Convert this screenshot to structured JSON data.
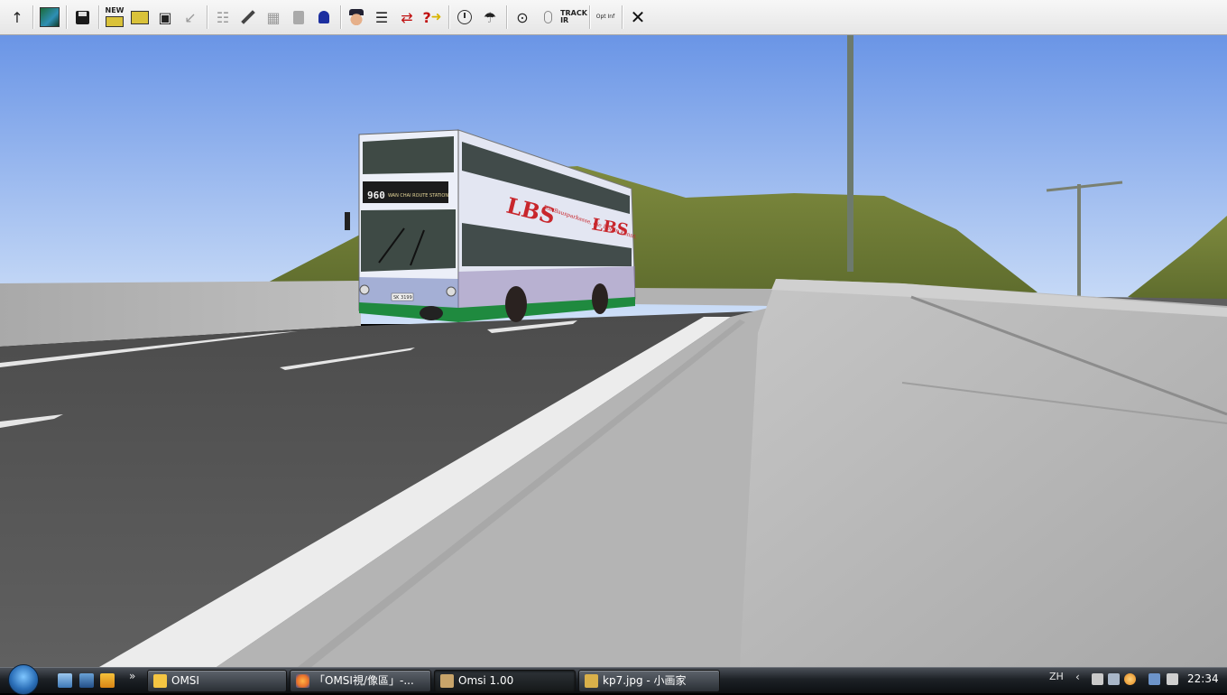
{
  "toolbar": {
    "buttons": [
      {
        "icon": "arrow-up-icon",
        "glyph": "↑"
      },
      {
        "icon": "map-view-icon",
        "glyph": ""
      },
      {
        "icon": "save-icon",
        "glyph": "💾"
      },
      {
        "icon": "new-bus-icon",
        "glyph": "",
        "label": "NEW"
      },
      {
        "icon": "bus-swap-icon",
        "glyph": "⇆"
      },
      {
        "icon": "frame-select-icon",
        "glyph": "▣"
      },
      {
        "icon": "pointer-icon",
        "glyph": "↙"
      },
      {
        "icon": "stats-icon",
        "glyph": "☷"
      },
      {
        "icon": "wrench-icon",
        "glyph": "🔧"
      },
      {
        "icon": "chip-icon",
        "glyph": "▦"
      },
      {
        "icon": "fuel-icon",
        "glyph": "⛽"
      },
      {
        "icon": "bell-icon",
        "glyph": "🔔"
      },
      {
        "icon": "driver-icon",
        "glyph": "👨"
      },
      {
        "icon": "timetable-icon",
        "glyph": "☰"
      },
      {
        "icon": "route-swap-icon",
        "glyph": "⇄"
      },
      {
        "icon": "help-icon",
        "glyph": "?"
      },
      {
        "icon": "clock-icon",
        "glyph": "⌚"
      },
      {
        "icon": "weather-icon",
        "glyph": "☂"
      },
      {
        "icon": "camera-icon",
        "glyph": "⊙"
      },
      {
        "icon": "mouse-icon",
        "glyph": "♘"
      },
      {
        "icon": "trackir-icon",
        "glyph": "",
        "label": "TRACK IR"
      },
      {
        "icon": "options-icon",
        "glyph": "",
        "label": "Opt Inf"
      },
      {
        "icon": "close-icon",
        "glyph": "✕"
      }
    ]
  },
  "scene": {
    "bus_route_number": "960",
    "bus_destination": "WAN CHAI  ROUTE  STATION",
    "ad_brand": "LBS",
    "ad_slogan": "Die Bausparkasse, die Berlin kennt.",
    "ad_brand_right": "LBS",
    "plate": "SK 3199"
  },
  "taskbar": {
    "start_label": "Start",
    "quick_launch_more": "»",
    "tasks": [
      {
        "label": "OMSI",
        "icon_color": "#f4c542",
        "active": false
      },
      {
        "label": "「OMSI視/像區」-...",
        "icon_color": "#e8702a",
        "active": false
      },
      {
        "label": "Omsi 1.00",
        "icon_color": "#c8a46a",
        "active": true
      },
      {
        "label": "kp7.jpg - 小画家",
        "icon_color": "#d9b04a",
        "active": false
      }
    ],
    "tray_language": "ZH",
    "tray_arrow": "‹",
    "clock": "22:34"
  },
  "colors": {
    "sky_top": "#6a95e6",
    "sky_bottom": "#cfe0f8",
    "hill": "#6f7a35",
    "road": "#5a5a5a",
    "pavement": "#b3b3b3",
    "bus_body": "#e9ecf6",
    "bus_skirt": "#1f8a3f"
  }
}
